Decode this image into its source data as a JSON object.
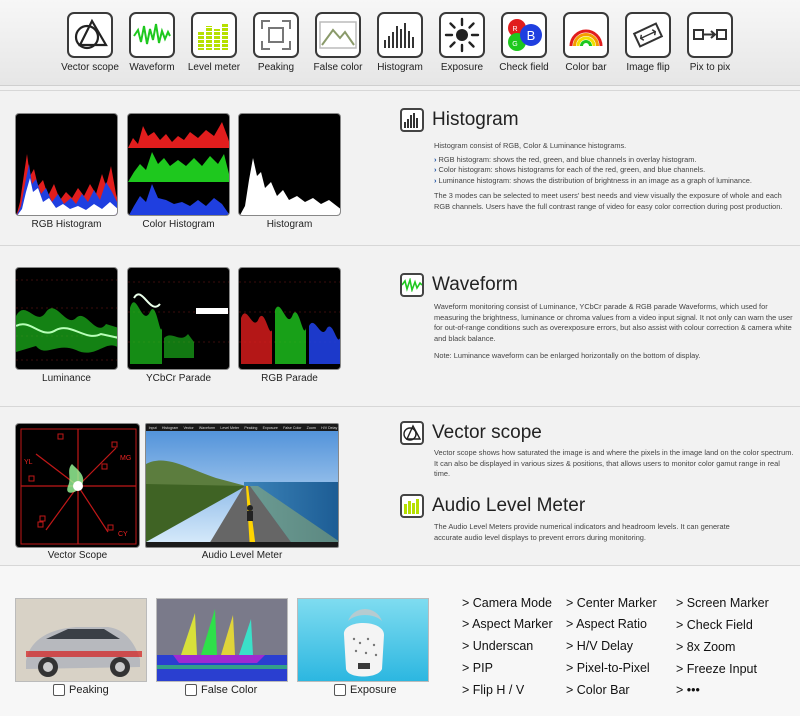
{
  "toolbar": {
    "tools": [
      {
        "label": "Vector scope",
        "icon": "vector-scope-icon"
      },
      {
        "label": "Waveform",
        "icon": "waveform-icon"
      },
      {
        "label": "Level meter",
        "icon": "level-meter-icon"
      },
      {
        "label": "Peaking",
        "icon": "peaking-icon"
      },
      {
        "label": "False color",
        "icon": "false-color-icon"
      },
      {
        "label": "Histogram",
        "icon": "histogram-icon"
      },
      {
        "label": "Exposure",
        "icon": "exposure-icon"
      },
      {
        "label": "Check field",
        "icon": "check-field-icon"
      },
      {
        "label": "Color bar",
        "icon": "color-bar-icon"
      },
      {
        "label": "Image flip",
        "icon": "image-flip-icon"
      },
      {
        "label": "Pix to pix",
        "icon": "pix-to-pix-icon"
      }
    ]
  },
  "histogram": {
    "title": "Histogram",
    "captions": [
      "RGB Histogram",
      "Color Histogram",
      "Histogram"
    ],
    "intro": "Histogram consist of RGB, Color & Luminance histograms.",
    "bullets": [
      "RGB histogram: shows the red, green, and blue channels in overlay histogram.",
      "Color histogram: shows histograms for each of the red, green, and blue channels.",
      "Luminance histogram: shows the distribution of brightness in an image as a graph of luminance."
    ],
    "outro": "The 3 modes can be selected to meet users' best needs and view visually the exposure of whole and each RGB channels. Users have the full contrast range of video for easy color correction during post production."
  },
  "waveform": {
    "title": "Waveform",
    "captions": [
      "Luminance",
      "YCbCr Parade",
      "RGB Parade"
    ],
    "body": "Waveform monitoring consist of Luminance, YCbCr parade & RGB parade Waveforms, which used for measuring the brightness, luminance or chroma values from a video input signal. It not only can warn the user for out-of-range conditions such as overexposure errors, but also assist with colour correction & camera white and black balance.",
    "note": "Note: Luminance waveform can be enlarged horizontally on the bottom of display."
  },
  "vectorscope": {
    "title": "Vector scope",
    "caption": "Vector Scope",
    "body": "Vector scope shows how saturated the image is and where the pixels in the image land on the color spectrum. It can also be displayed in various sizes & positions, that allows users to monitor color gamut range in real time.",
    "labels": {
      "mg": "MG",
      "yl": "YL",
      "cy": "CY"
    }
  },
  "audio": {
    "title": "Audio Level Meter",
    "caption": "Audio Level Meter",
    "body": "The Audio Level Meters provide numerical indicators and headroom levels. It can generate accurate audio level displays to prevent errors during monitoring.",
    "menu": [
      "Input",
      "Histogram",
      "Vector",
      "Waveform",
      "Level Meter",
      "Peaking",
      "Exposure",
      "False Color",
      "Zoom",
      "H/V Delay"
    ]
  },
  "bottom": {
    "captions": [
      "Peaking",
      "False Color",
      "Exposure"
    ],
    "features": [
      "> Camera Mode",
      "> Center Marker",
      "> Screen Marker",
      "> Aspect Marker",
      "> Aspect Ratio",
      "> Check Field",
      "> Underscan",
      "> H/V Delay",
      "> 8x Zoom",
      "> PIP",
      "> Pixel-to-Pixel",
      "> Freeze Input",
      "> Flip H / V",
      "> Color Bar",
      "> •••"
    ]
  },
  "colors": {
    "red": "#e11d1d",
    "green": "#1ec81e",
    "blue": "#1f3fe0",
    "accent": "#1a4fa0"
  }
}
